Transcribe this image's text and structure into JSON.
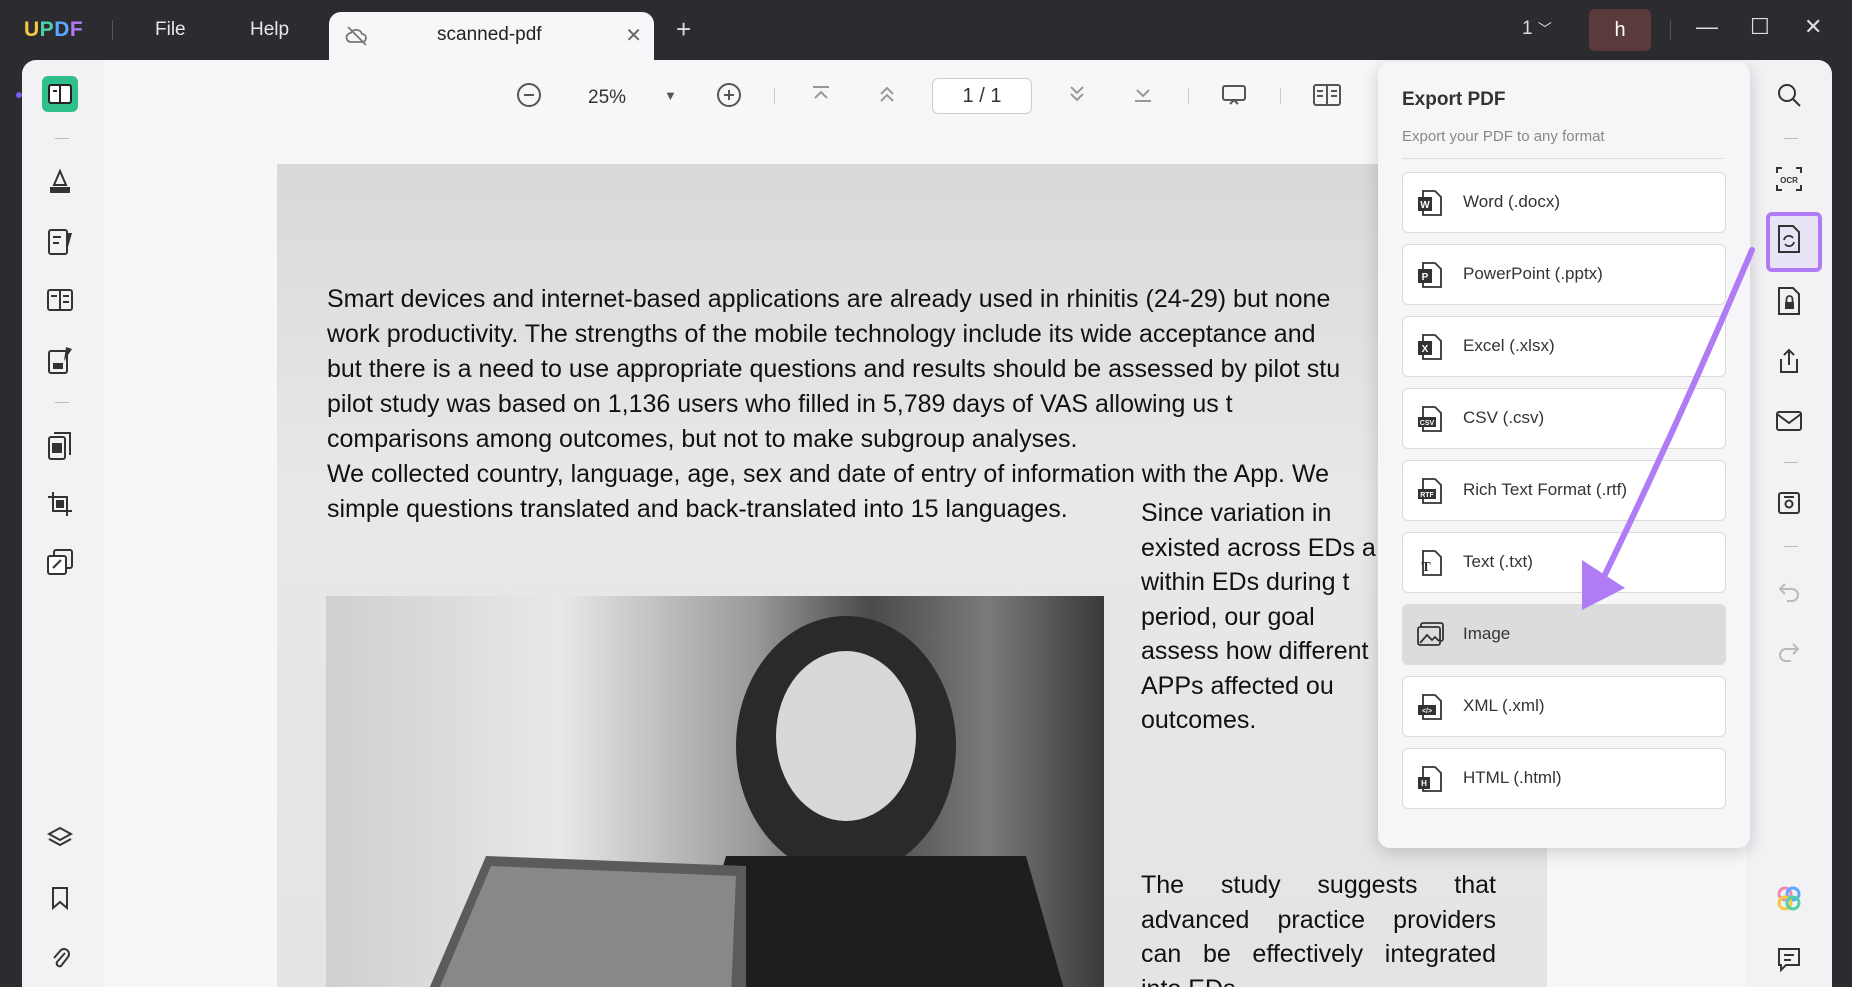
{
  "titlebar": {
    "logo": "UPDF",
    "menu": [
      "File",
      "Help"
    ],
    "tab_name": "scanned-pdf",
    "page_count": "1",
    "avatar_initial": "h"
  },
  "toolbar": {
    "zoom": "25%",
    "page_indicator": "1 / 1"
  },
  "document": {
    "paragraph_lines": [
      "Smart devices and internet-based applications are already used in rhinitis (24-29) but none",
      "work productivity. The strengths of the mobile technology include its wide acceptance and",
      "but there is a need to use appropriate questions and results should be assessed by pilot stu",
      "pilot study was based on 1,136 users who filled in 5,789 days of VAS allowing us t",
      "comparisons among outcomes, but not to make subgroup analyses.",
      "We collected country, language, age, sex and date of entry of information with the App. We",
      "simple questions translated and back-translated into 15 languages."
    ],
    "column1_lines": [
      "Since variation in",
      "existed across EDs a",
      "within EDs during t",
      "period, our goal",
      "assess how different",
      "APPs affected ou",
      "outcomes."
    ],
    "column2_lines": [
      "The study suggests that",
      "advanced practice providers",
      "can be effectively integrated",
      "into EDs"
    ]
  },
  "export_panel": {
    "title": "Export PDF",
    "subtitle": "Export your PDF to any format",
    "options": [
      {
        "label": "Word (.docx)",
        "icon": "word-icon",
        "selected": false
      },
      {
        "label": "PowerPoint (.pptx)",
        "icon": "powerpoint-icon",
        "selected": false
      },
      {
        "label": "Excel (.xlsx)",
        "icon": "excel-icon",
        "selected": false
      },
      {
        "label": "CSV (.csv)",
        "icon": "csv-icon",
        "selected": false
      },
      {
        "label": "Rich Text Format (.rtf)",
        "icon": "rtf-icon",
        "selected": false
      },
      {
        "label": "Text (.txt)",
        "icon": "text-icon",
        "selected": false
      },
      {
        "label": "Image",
        "icon": "image-icon",
        "selected": true
      },
      {
        "label": "XML (.xml)",
        "icon": "xml-icon",
        "selected": false
      },
      {
        "label": "HTML (.html)",
        "icon": "html-icon",
        "selected": false
      }
    ]
  },
  "colors": {
    "accent": "#b07cf5",
    "arrow": "#b07cf5",
    "logo_gradient": [
      "#f5c842",
      "#4fd1a5",
      "#5aa8ff",
      "#b07cf5"
    ]
  }
}
